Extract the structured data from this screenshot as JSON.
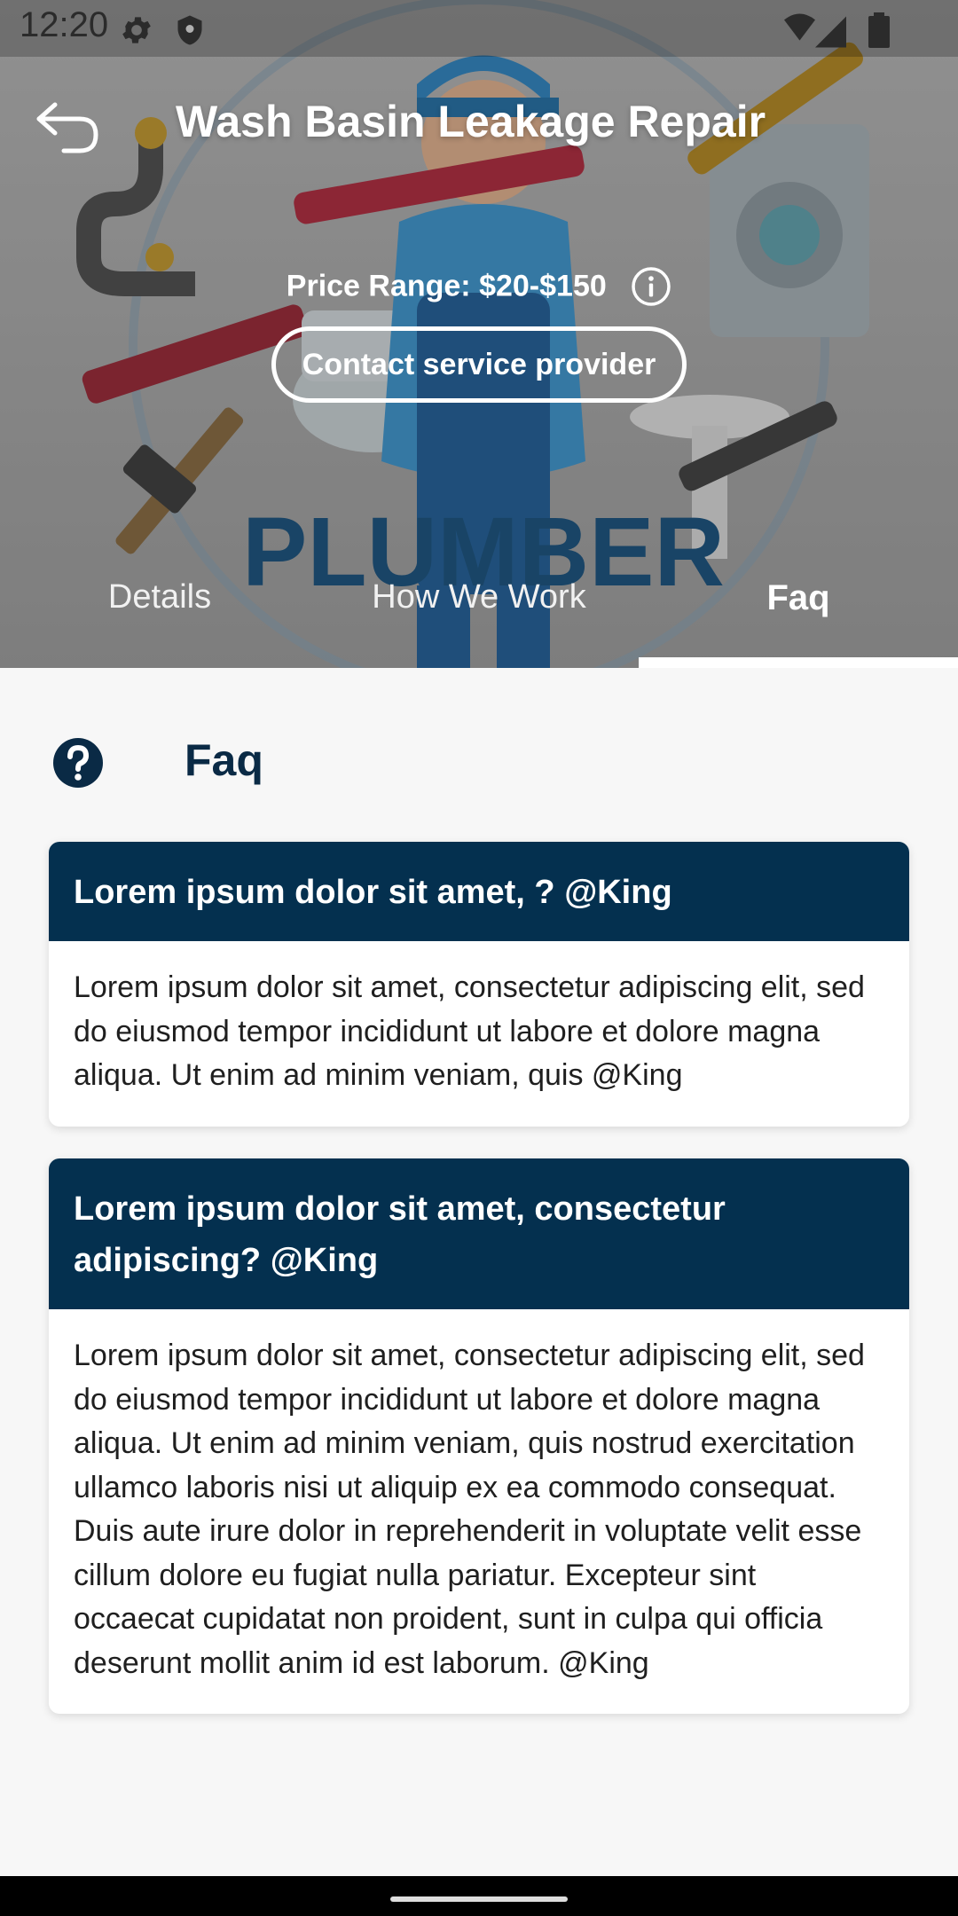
{
  "status_bar": {
    "time": "12:20"
  },
  "header": {
    "title": "Wash Basin Leakage Repair",
    "price_range": "Price Range: $20-$150",
    "contact_button": "Contact service provider",
    "hero_brand": "PLUMBER"
  },
  "tabs": [
    {
      "label": "Details",
      "active": false
    },
    {
      "label": "How We Work",
      "active": false
    },
    {
      "label": "Faq",
      "active": true
    }
  ],
  "faq": {
    "title": "Faq",
    "items": [
      {
        "question": "Lorem ipsum dolor sit amet, ? @King",
        "answer": "Lorem ipsum dolor sit amet, consectetur adipiscing elit, sed do eiusmod tempor incididunt ut labore et dolore magna aliqua. Ut enim ad minim veniam, quis @King"
      },
      {
        "question": "Lorem ipsum dolor sit amet, consectetur adipiscing? @King",
        "answer": "Lorem ipsum dolor sit amet, consectetur adipiscing elit, sed do eiusmod tempor incididunt ut labore et dolore magna aliqua. Ut enim ad minim veniam, quis nostrud exercitation ullamco laboris nisi ut aliquip ex ea commodo consequat. Duis aute irure dolor in reprehenderit in voluptate velit esse cillum dolore eu fugiat nulla pariatur. Excepteur sint occaecat cupidatat non proident, sunt in culpa qui officia deserunt mollit anim id est laborum. @King"
      }
    ]
  },
  "colors": {
    "primary_navy": "#04304f",
    "title_navy": "#0a2a45",
    "background": "#f7f7f7"
  },
  "icons": [
    "settings-icon",
    "shield-icon",
    "signal-icon",
    "battery-icon",
    "back-arrow-icon",
    "info-icon",
    "help-circle-icon"
  ]
}
